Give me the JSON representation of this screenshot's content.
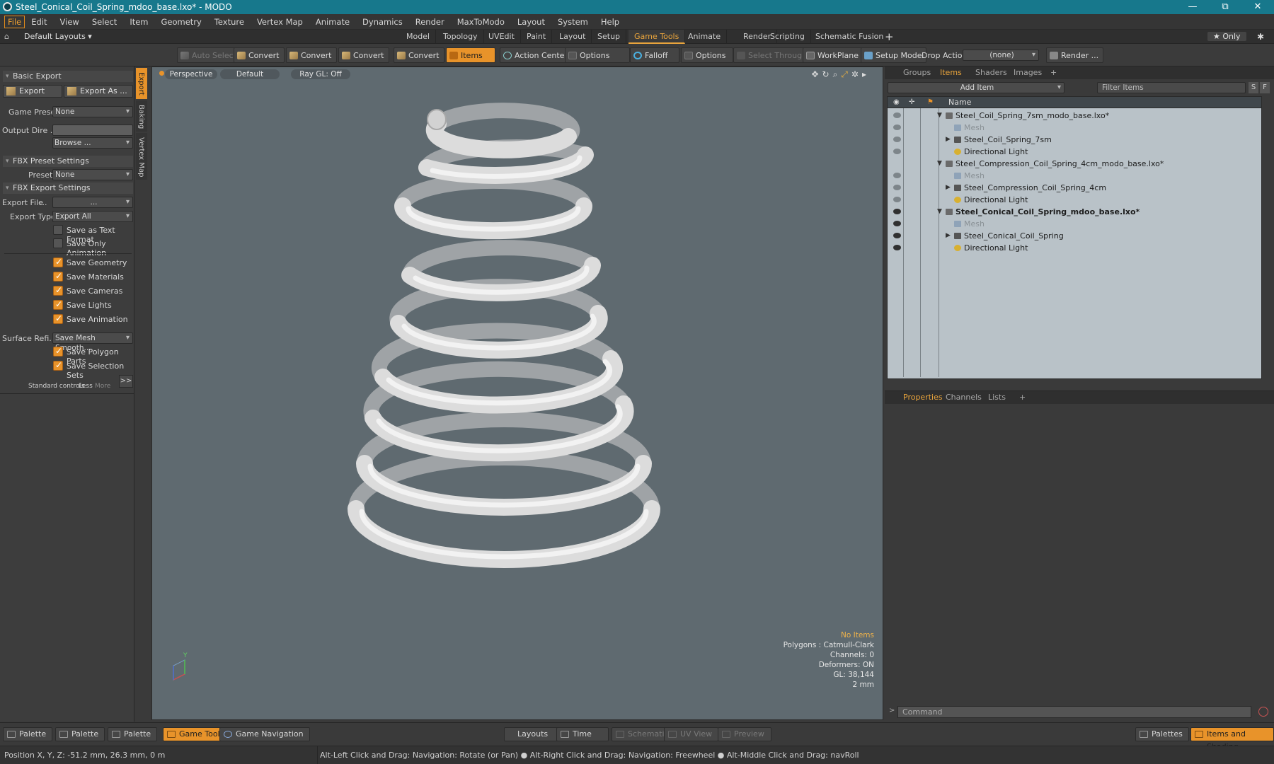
{
  "window": {
    "title": "Steel_Conical_Coil_Spring_mdoo_base.lxo* - MODO",
    "controls": [
      "—",
      "⧉",
      "✕"
    ]
  },
  "menu": [
    "File",
    "Edit",
    "View",
    "Select",
    "Item",
    "Geometry",
    "Texture",
    "Vertex Map",
    "Animate",
    "Dynamics",
    "Render",
    "MaxToModo",
    "Layout",
    "System",
    "Help"
  ],
  "layout_bar": {
    "preset": "Default Layouts ▾",
    "tabs": [
      "Model",
      "Topology",
      "UVEdit",
      "Paint",
      "Layout",
      "Setup",
      "Game Tools",
      "Animate",
      "Render",
      "Scripting",
      "Schematic Fusion"
    ],
    "active_tab": "Game Tools",
    "add": "+",
    "only": "★  Only",
    "settings": "✱"
  },
  "toolbar": {
    "auto_select": "Auto Select",
    "convert1": "Convert",
    "convert2": "Convert",
    "convert3": "Convert",
    "convert4": "Convert",
    "items": "Items",
    "action_center": "Action Center",
    "options1": "Options",
    "falloff": "Falloff",
    "options2": "Options",
    "select_through": "Select Through",
    "workplane": "WorkPlane",
    "setup_mode": "Setup Mode",
    "drop_action": "Drop Action",
    "drop_value": "(none)",
    "render": "Render ..."
  },
  "left": {
    "basic_export": "Basic Export",
    "export": "Export",
    "export_as": "Export As ...",
    "game_preset_label": "Game Preset",
    "game_preset_value": "None",
    "output_dir_label": "Output Dire ...",
    "browse": "Browse ...",
    "fbx_preset_settings": "FBX Preset Settings",
    "preset_label": "Preset",
    "preset_value": "None",
    "fbx_export_settings": "FBX Export Settings",
    "export_file_label": "Export File",
    "export_file_dots": "...",
    "export_file_value": "...",
    "export_type_label": "Export Type",
    "export_type_value": "Export All",
    "checks": [
      {
        "label": "Save as Text Format",
        "on": false
      },
      {
        "label": "Save Only Animation",
        "on": false
      },
      {
        "label": "Save Geometry",
        "on": true
      },
      {
        "label": "Save Materials",
        "on": true
      },
      {
        "label": "Save Cameras",
        "on": true
      },
      {
        "label": "Save Lights",
        "on": true
      },
      {
        "label": "Save Animation",
        "on": true
      }
    ],
    "surface_label": "Surface Refi...",
    "surface_value": "Save Mesh Smooth...",
    "checks2": [
      {
        "label": "Save Polygon Parts",
        "on": true
      },
      {
        "label": "Save Selection Sets",
        "on": true
      }
    ],
    "standard_controls": "Standard controls",
    "less": "Less",
    "more": "More",
    "arrow": ">>",
    "side_tabs": [
      "Export",
      "Baking",
      "Vertex Map"
    ]
  },
  "viewport": {
    "perspective": "Perspective",
    "default": "Default",
    "raygl": "Ray GL: Off",
    "info": {
      "no_items": "No Items",
      "polygons": "Polygons : Catmull-Clark",
      "channels": "Channels: 0",
      "deformers": "Deformers: ON",
      "gl": "GL: 38,144",
      "scale": "2 mm"
    },
    "axis_y": "Y"
  },
  "items_panel": {
    "tabs": [
      "Groups",
      "Items",
      "Shaders",
      "Images"
    ],
    "active_tab": "Items",
    "add_item": "Add Item",
    "filter": "Filter Items",
    "s_btn": "S",
    "f_btn": "F",
    "name_header": "Name",
    "rows": [
      {
        "label": "Steel_Coil_Spring_7sm_modo_base.lxo*",
        "level": 0,
        "type": "scene",
        "eye": "light"
      },
      {
        "label": "Mesh",
        "level": 1,
        "type": "mesh",
        "eye": "light",
        "muted": true
      },
      {
        "label": "Steel_Coil_Spring_7sm",
        "level": 1,
        "type": "group",
        "eye": "light"
      },
      {
        "label": "Directional Light",
        "level": 1,
        "type": "light",
        "eye": "light"
      },
      {
        "label": "Steel_Compression_Coil_Spring_4cm_modo_base.lxo*",
        "level": 0,
        "type": "scene",
        "eye": "none"
      },
      {
        "label": "Mesh",
        "level": 1,
        "type": "mesh",
        "eye": "light",
        "muted": true
      },
      {
        "label": "Steel_Compression_Coil_Spring_4cm",
        "level": 1,
        "type": "group",
        "eye": "light"
      },
      {
        "label": "Directional Light",
        "level": 1,
        "type": "light",
        "eye": "light"
      },
      {
        "label": "Steel_Conical_Coil_Spring_mdoo_base.lxo*",
        "level": 0,
        "type": "scene",
        "eye": "dark",
        "bold": true
      },
      {
        "label": "Mesh",
        "level": 1,
        "type": "mesh",
        "eye": "dark",
        "muted": true
      },
      {
        "label": "Steel_Conical_Coil_Spring",
        "level": 1,
        "type": "group",
        "eye": "dark"
      },
      {
        "label": "Directional Light",
        "level": 1,
        "type": "light",
        "eye": "dark"
      }
    ]
  },
  "props_panel": {
    "tabs": [
      "Properties",
      "Channels",
      "Lists"
    ],
    "active_tab": "Properties",
    "command_placeholder": "Command"
  },
  "bottom": {
    "palette1": "Palette",
    "palette2": "Palette",
    "palette3": "Palette",
    "game_tools": "Game Tools",
    "game_navigation": "Game Navigation",
    "layouts": "Layouts",
    "time": "Time",
    "schematic": "Schematic",
    "uv_view": "UV View",
    "preview": "Preview",
    "palettes": "Palettes",
    "items_and_shading": "Items and Shading"
  },
  "status": {
    "position": "Position X, Y, Z:   -51.2 mm, 26.3 mm, 0 m",
    "hint": "Alt-Left Click and Drag: Navigation: Rotate (or Pan) ● Alt-Right Click and Drag: Navigation: Freewheel ● Alt-Middle Click and Drag: navRoll"
  },
  "colors": {
    "accent": "#e8932a",
    "titlebar": "#17788c",
    "viewport_bg": "#5f6a70",
    "item_list_bg": "#b9c2c8",
    "spring": "#e4e4e4"
  }
}
